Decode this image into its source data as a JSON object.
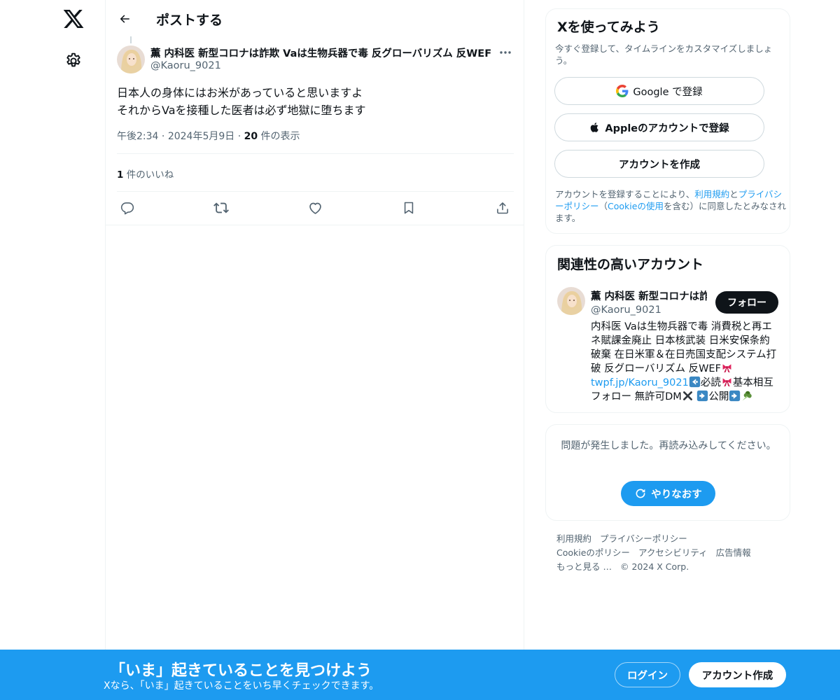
{
  "nav": {
    "logo_icon": "x-logo-icon",
    "settings_icon": "gear-icon"
  },
  "header": {
    "back_icon": "arrow-left-icon",
    "title": "ポストする"
  },
  "post": {
    "author_name": "薫 内科医 新型コロナは詐欺 Vaは生物兵器で毒 反グローバリズム 反WEF",
    "author_handle": "@Kaoru_9021",
    "text_lines": [
      "日本人の身体にはお米があっていると思いますよ",
      "それからVaを接種した医者は必ず地獄に堕ちます"
    ],
    "time": "午後2:34",
    "sep": "·",
    "date": "2024年5月9日",
    "views_count": "20",
    "views_label": " 件の表示",
    "likes_count": "1",
    "likes_label": " 件のいいね",
    "actions": [
      "reply-icon",
      "repost-icon",
      "like-icon",
      "bookmark-icon",
      "share-icon"
    ]
  },
  "signup_card": {
    "title": "Xを使ってみよう",
    "subtitle": "今すぐ登録して、タイムラインをカスタマイズしましょう。",
    "google_label": "Google で登録",
    "apple_label": "Appleのアカウントで登録",
    "create_label": "アカウントを作成",
    "terms_prefix": "アカウントを登録することにより、",
    "terms_link": "利用規約",
    "terms_and": "と",
    "privacy_link": "プライバシーポリシー",
    "terms_mid": "（",
    "cookie_link": "Cookieの使用",
    "terms_suffix": "を含む）に同意したとみなされます。"
  },
  "related_card": {
    "title": "関連性の高いアカウント",
    "name": "薫 内科医 新型コロナは詐欺 Vaは生物兵器で毒",
    "handle": "@Kaoru_9021",
    "follow_label": "フォロー",
    "bio_text": "内科医 Vaは生物兵器で毒 消費税と再エネ賦課金廃止 日本核武装 日米安保条約破棄 在日米軍＆在日売国支配システム打破 反グローバリズム 反WEF",
    "bio_link": "twpf.jp/Kaoru_9021",
    "bio_tail1": "必読",
    "bio_tail2": "基本相互フォロー 無許可DM",
    "bio_tail3": "公開"
  },
  "error_card": {
    "message": "問題が発生しました。再読み込みしてください。",
    "retry_label": "やりなおす"
  },
  "footer": {
    "links": [
      "利用規約",
      "プライバシーポリシー",
      "Cookieのポリシー",
      "アクセシビリティ",
      "広告情報",
      "もっと見る …",
      "© 2024 X Corp."
    ]
  },
  "bottom_bar": {
    "title": "「いま」起きていることを見つけよう",
    "subtitle": "Xなら、「いま」起きていることをいち早くチェックできます。",
    "login_label": "ログイン",
    "signup_label": "アカウント作成"
  },
  "colors": {
    "accent": "#1d9bf0",
    "text_primary": "#0f1419",
    "text_secondary": "#536471",
    "border": "#eff3f4"
  }
}
